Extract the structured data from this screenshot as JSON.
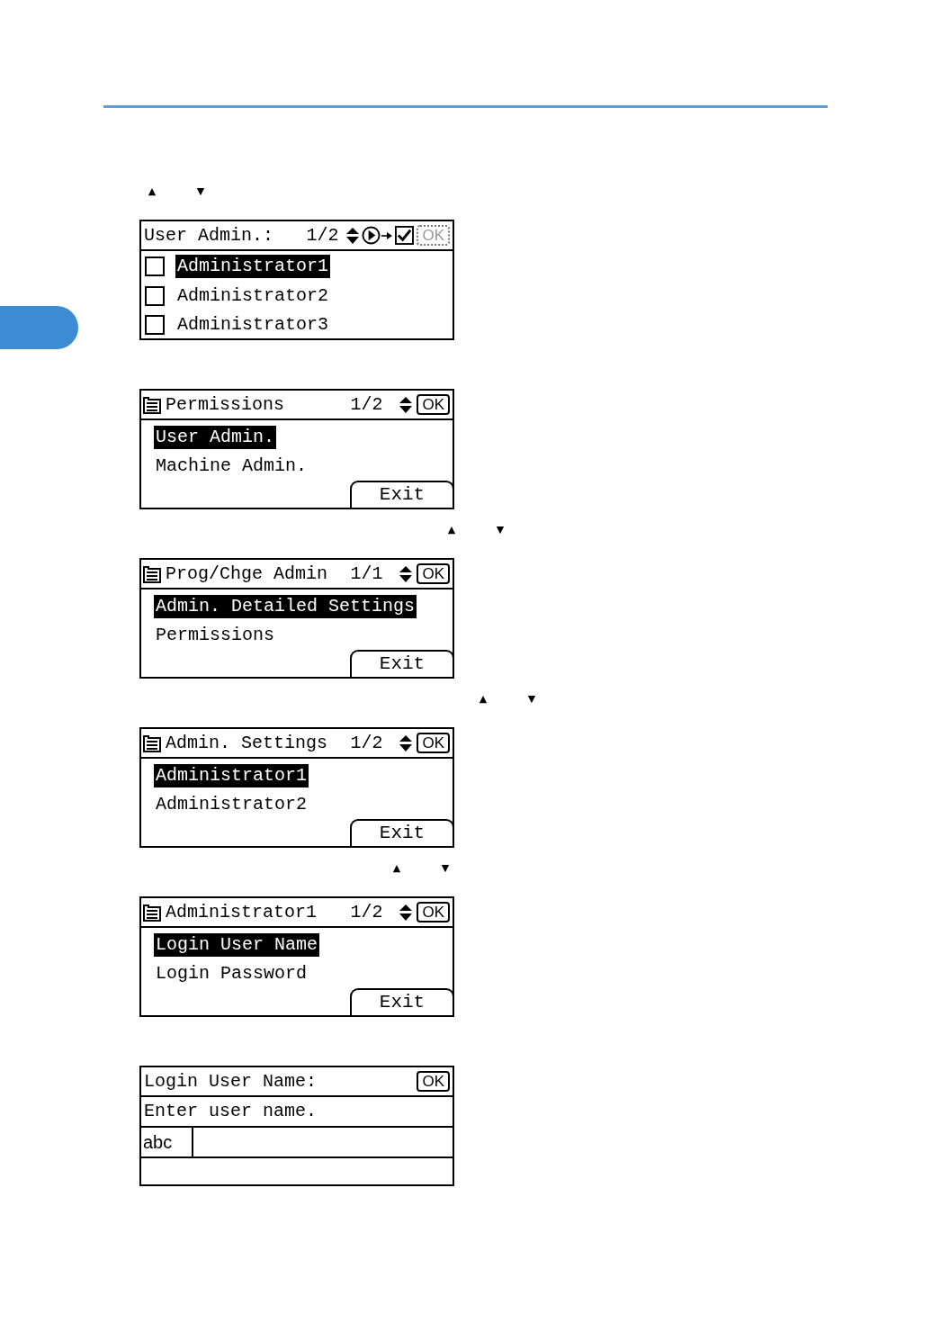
{
  "steps": [
    {
      "arrow_keys": [
        "▲",
        "▼"
      ],
      "panel": {
        "kind": "checklist",
        "title": "User Admin.:",
        "page": "1/2",
        "ok_button": {
          "label": "OK",
          "disabled": true
        },
        "items": [
          {
            "label": "Administrator1",
            "selected": true,
            "checked": false
          },
          {
            "label": "Administrator2",
            "selected": false,
            "checked": false
          },
          {
            "label": "Administrator3",
            "selected": false,
            "checked": false
          }
        ]
      }
    },
    {
      "panel": {
        "kind": "menu",
        "title": "Permissions",
        "page": "1/2",
        "ok_button": {
          "label": "OK",
          "disabled": false
        },
        "items": [
          {
            "label": "User Admin.",
            "selected": true
          },
          {
            "label": "Machine Admin.",
            "selected": false
          }
        ],
        "exit_button": "Exit"
      }
    },
    {
      "arrow_keys": [
        "▲",
        "▼"
      ],
      "panel": {
        "kind": "menu",
        "title": "Prog/Chge Admin",
        "page": "1/1",
        "ok_button": {
          "label": "OK",
          "disabled": false
        },
        "items": [
          {
            "label": "Admin. Detailed Settings",
            "selected": true
          },
          {
            "label": "Permissions",
            "selected": false
          }
        ],
        "exit_button": "Exit"
      }
    },
    {
      "arrow_keys": [
        "▲",
        "▼"
      ],
      "panel": {
        "kind": "menu",
        "title": "Admin. Settings",
        "page": "1/2",
        "ok_button": {
          "label": "OK",
          "disabled": false
        },
        "items": [
          {
            "label": "Administrator1",
            "selected": true
          },
          {
            "label": "Administrator2",
            "selected": false
          }
        ],
        "exit_button": "Exit"
      }
    },
    {
      "arrow_keys": [
        "▲",
        "▼"
      ],
      "panel": {
        "kind": "menu",
        "title": "Administrator1",
        "page": "1/2",
        "ok_button": {
          "label": "OK",
          "disabled": false
        },
        "items": [
          {
            "label": "Login User Name",
            "selected": true
          },
          {
            "label": "Login Password",
            "selected": false
          }
        ],
        "exit_button": "Exit"
      }
    },
    {
      "panel": {
        "kind": "entry",
        "title": "Login User Name:",
        "ok_button": {
          "label": "OK",
          "disabled": false
        },
        "message": "Enter user name.",
        "mode": "abc"
      }
    }
  ]
}
